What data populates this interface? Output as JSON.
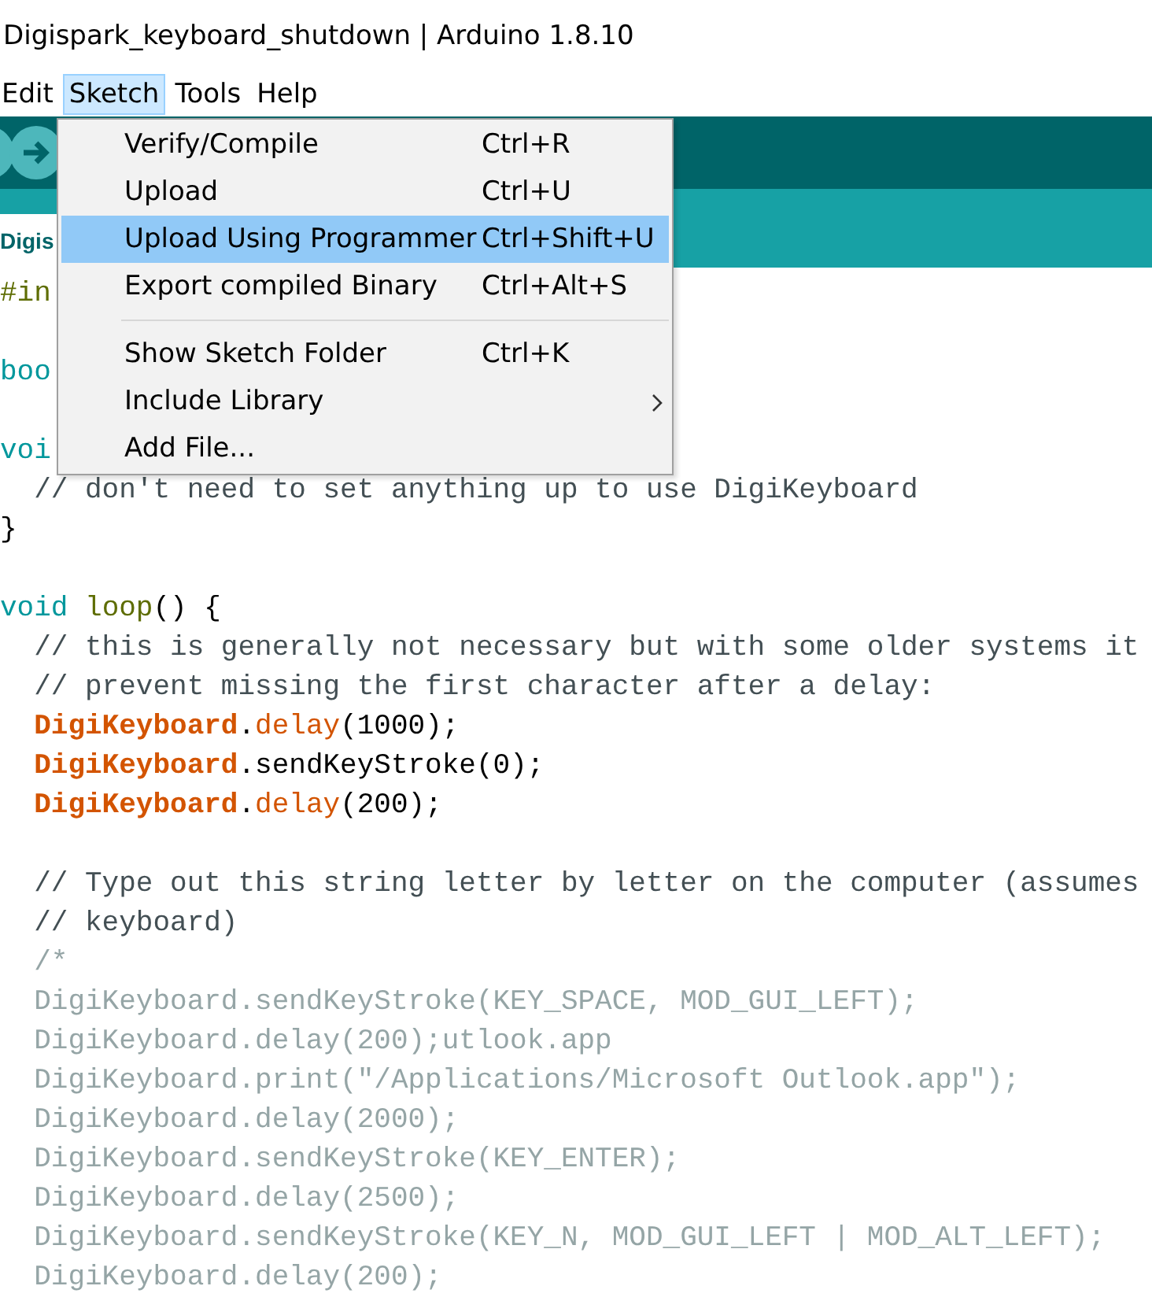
{
  "window": {
    "title": "Digispark_keyboard_shutdown | Arduino 1.8.10"
  },
  "menu_bar": [
    {
      "label": "Edit",
      "selected": false
    },
    {
      "label": "Sketch",
      "selected": true
    },
    {
      "label": "Tools",
      "selected": false
    },
    {
      "label": "Help",
      "selected": false
    }
  ],
  "tabs": [
    {
      "label": "Digis",
      "selected": true
    }
  ],
  "sketch_menu": [
    {
      "kind": "item",
      "label": "Verify/Compile",
      "shortcut": "Ctrl+R",
      "selected": false,
      "submenu": false
    },
    {
      "kind": "item",
      "label": "Upload",
      "shortcut": "Ctrl+U",
      "selected": false,
      "submenu": false
    },
    {
      "kind": "item",
      "label": "Upload Using Programmer",
      "shortcut": "Ctrl+Shift+U",
      "selected": true,
      "submenu": false
    },
    {
      "kind": "item",
      "label": "Export compiled Binary",
      "shortcut": "Ctrl+Alt+S",
      "selected": false,
      "submenu": false
    },
    {
      "kind": "separator"
    },
    {
      "kind": "item",
      "label": "Show Sketch Folder",
      "shortcut": "Ctrl+K",
      "selected": false,
      "submenu": false
    },
    {
      "kind": "item",
      "label": "Include Library",
      "selected": false,
      "submenu": true
    },
    {
      "kind": "item",
      "label": "Add File...",
      "selected": false,
      "submenu": false
    }
  ],
  "code_lines": [
    {
      "kind": "code",
      "segments": [
        {
          "text": "#in",
          "kind": "preprocessor"
        }
      ]
    },
    {
      "kind": "blank"
    },
    {
      "kind": "code",
      "segments": [
        {
          "text": "boo",
          "kind": "keyword"
        }
      ]
    },
    {
      "kind": "blank"
    },
    {
      "kind": "code",
      "segments": [
        {
          "text": "voi",
          "kind": "keyword"
        }
      ]
    },
    {
      "kind": "code",
      "segments": [
        {
          "text": "  // don't need to set anything up to use DigiKeyboard",
          "kind": "comment"
        }
      ]
    },
    {
      "kind": "code",
      "segments": [
        {
          "text": "}",
          "kind": "plain"
        }
      ]
    },
    {
      "kind": "blank"
    },
    {
      "kind": "code",
      "segments": [
        {
          "text": "void",
          "kind": "keyword"
        },
        {
          "text": " loop",
          "kind": "function"
        },
        {
          "text": "() {",
          "kind": "plain"
        }
      ]
    },
    {
      "kind": "code",
      "segments": [
        {
          "text": "  // this is generally not necessary but with some older systems it",
          "kind": "comment"
        }
      ]
    },
    {
      "kind": "code",
      "segments": [
        {
          "text": "  // prevent missing the first character after a delay:",
          "kind": "comment"
        }
      ]
    },
    {
      "kind": "code",
      "segments": [
        {
          "text": "  DigiKeyboard",
          "kind": "class"
        },
        {
          "text": ".",
          "kind": "plain"
        },
        {
          "text": "delay",
          "kind": "method"
        },
        {
          "text": "(1000);",
          "kind": "plain"
        }
      ]
    },
    {
      "kind": "code",
      "segments": [
        {
          "text": "  DigiKeyboard",
          "kind": "class"
        },
        {
          "text": ".sendKeyStroke(0);",
          "kind": "plain"
        }
      ]
    },
    {
      "kind": "code",
      "segments": [
        {
          "text": "  DigiKeyboard",
          "kind": "class"
        },
        {
          "text": ".",
          "kind": "plain"
        },
        {
          "text": "delay",
          "kind": "method"
        },
        {
          "text": "(200);",
          "kind": "plain"
        }
      ]
    },
    {
      "kind": "blank"
    },
    {
      "kind": "code",
      "segments": [
        {
          "text": "  // Type out this string letter by letter on the computer (assumes",
          "kind": "comment"
        }
      ]
    },
    {
      "kind": "code",
      "segments": [
        {
          "text": "  // keyboard)",
          "kind": "comment"
        }
      ]
    },
    {
      "kind": "code",
      "segments": [
        {
          "text": "  /*",
          "kind": "block_comment"
        }
      ]
    },
    {
      "kind": "code",
      "segments": [
        {
          "text": "  DigiKeyboard.sendKeyStroke(KEY_SPACE, MOD_GUI_LEFT);",
          "kind": "block_comment"
        }
      ]
    },
    {
      "kind": "code",
      "segments": [
        {
          "text": "  DigiKeyboard.delay(200);utlook.app",
          "kind": "block_comment"
        }
      ]
    },
    {
      "kind": "code",
      "segments": [
        {
          "text": "  DigiKeyboard.print(\"/Applications/Microsoft Outlook.app\");",
          "kind": "block_comment"
        }
      ]
    },
    {
      "kind": "code",
      "segments": [
        {
          "text": "  DigiKeyboard.delay(2000);",
          "kind": "block_comment"
        }
      ]
    },
    {
      "kind": "code",
      "segments": [
        {
          "text": "  DigiKeyboard.sendKeyStroke(KEY_ENTER);",
          "kind": "block_comment"
        }
      ]
    },
    {
      "kind": "code",
      "segments": [
        {
          "text": "  DigiKeyboard.delay(2500);",
          "kind": "block_comment"
        }
      ]
    },
    {
      "kind": "code",
      "segments": [
        {
          "text": "  DigiKeyboard.sendKeyStroke(KEY_N, MOD_GUI_LEFT | MOD_ALT_LEFT);",
          "kind": "block_comment"
        }
      ]
    },
    {
      "kind": "code",
      "segments": [
        {
          "text": "  DigiKeyboard.delay(200);",
          "kind": "block_comment"
        }
      ]
    }
  ]
}
